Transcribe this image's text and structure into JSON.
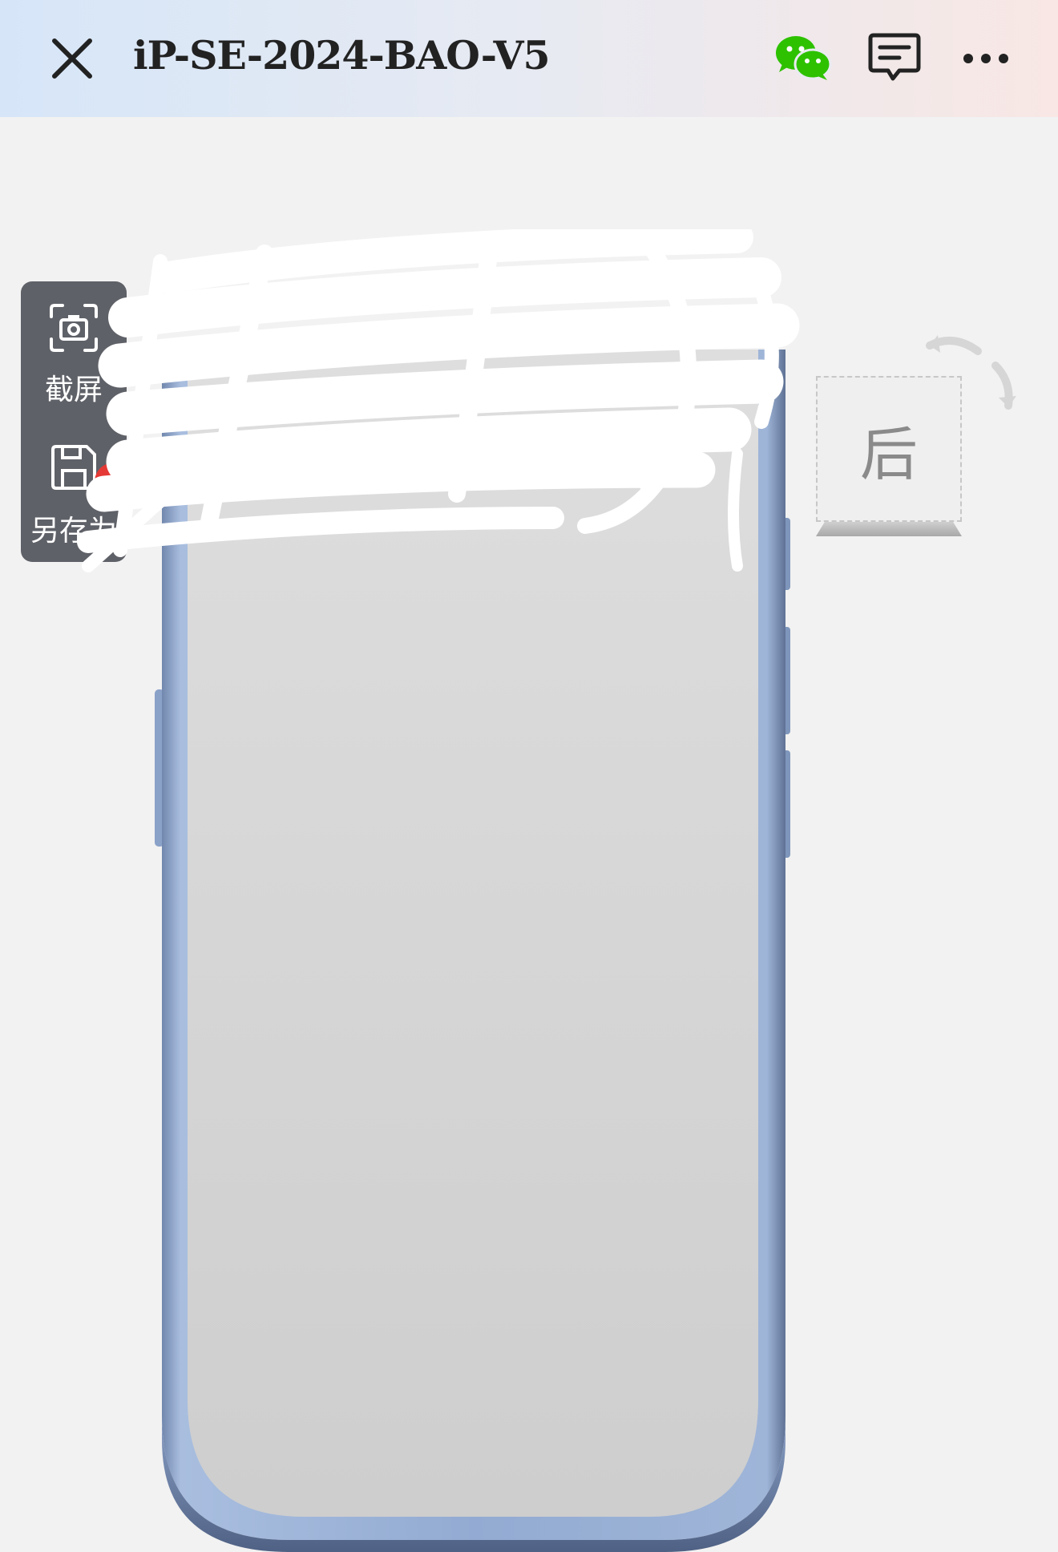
{
  "header": {
    "title": "iP-SE-2024-BAO-V5",
    "close_icon": "close-icon",
    "wechat_icon": "wechat-icon",
    "message_icon": "message-icon",
    "more_icon": "more-icon",
    "wechat_color": "#2dc100"
  },
  "toolbar": {
    "screenshot_label": "截屏",
    "save_as_label": "另存为",
    "new_badge": "新",
    "screenshot_icon": "camera-frame-icon",
    "save_as_icon": "save-icon"
  },
  "viewcube": {
    "face_label": "后",
    "rotate_icon": "rotate-icon"
  },
  "colors": {
    "background": "#f2f2f2",
    "toolbar_bg": "#5f6168",
    "badge": "#e53935",
    "phone_frame": "#8fa7cd",
    "phone_screen": "#d4d4d4"
  }
}
